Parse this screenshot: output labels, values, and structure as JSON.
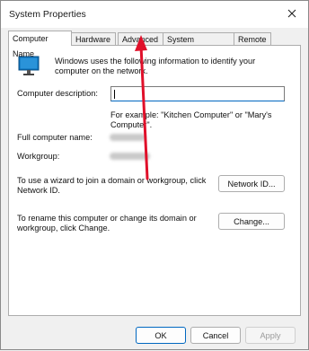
{
  "window": {
    "title": "System Properties"
  },
  "tabs": [
    {
      "label": "Computer Name",
      "active": true
    },
    {
      "label": "Hardware",
      "active": false
    },
    {
      "label": "Advanced",
      "active": false
    },
    {
      "label": "System Protection",
      "active": false
    },
    {
      "label": "Remote",
      "active": false
    }
  ],
  "panel": {
    "intro": "Windows uses the following information to identify your computer on the network.",
    "description_label": "Computer description:",
    "description_value": "",
    "example": "For example: \"Kitchen Computer\" or \"Mary's Computer\".",
    "full_name_label": "Full computer name:",
    "workgroup_label": "Workgroup:",
    "networkid_text": "To use a wizard to join a domain or workgroup, click Network ID.",
    "networkid_button": "Network ID...",
    "change_text": "To rename this computer or change its domain or workgroup, click Change.",
    "change_button": "Change..."
  },
  "footer": {
    "ok": "OK",
    "cancel": "Cancel",
    "apply": "Apply"
  },
  "colors": {
    "accent": "#0067c0",
    "annotation_arrow": "#e0102a"
  },
  "icons": {
    "computer": "monitor-icon",
    "close": "close-icon"
  }
}
